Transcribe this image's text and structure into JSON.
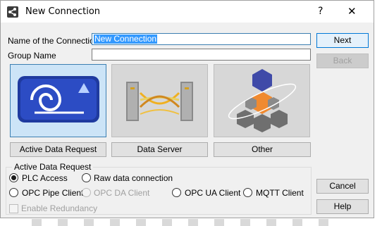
{
  "window": {
    "title": "New Connection",
    "help_glyph": "?",
    "close_glyph": "✕"
  },
  "form": {
    "connection_name_label": "Name of the Connection",
    "connection_name_value": "New Connection",
    "group_name_label": "Group Name",
    "group_name_value": ""
  },
  "buttons": {
    "next": "Next",
    "back": "Back",
    "cancel": "Cancel",
    "help": "Help"
  },
  "tiles": [
    {
      "label": "Active Data Request",
      "icon": "active-data-request-icon",
      "selected": true
    },
    {
      "label": "Data Server",
      "icon": "data-server-icon",
      "selected": false
    },
    {
      "label": "Other",
      "icon": "other-cubes-icon",
      "selected": false
    }
  ],
  "group": {
    "title": "Active Data Request",
    "options": [
      {
        "label": "PLC Access",
        "checked": true,
        "enabled": true
      },
      {
        "label": "Raw data connection",
        "checked": false,
        "enabled": true
      },
      {
        "label": "OPC Pipe Client",
        "checked": false,
        "enabled": true
      },
      {
        "label": "OPC DA Client",
        "checked": false,
        "enabled": false
      },
      {
        "label": "OPC UA Client",
        "checked": false,
        "enabled": true
      },
      {
        "label": "MQTT Client",
        "checked": false,
        "enabled": true
      }
    ],
    "redundancy_label": "Enable Redundancy"
  },
  "colors": {
    "accent": "#0078d7",
    "selection": "#3399ff",
    "tile_selected": "#cce4f7"
  }
}
